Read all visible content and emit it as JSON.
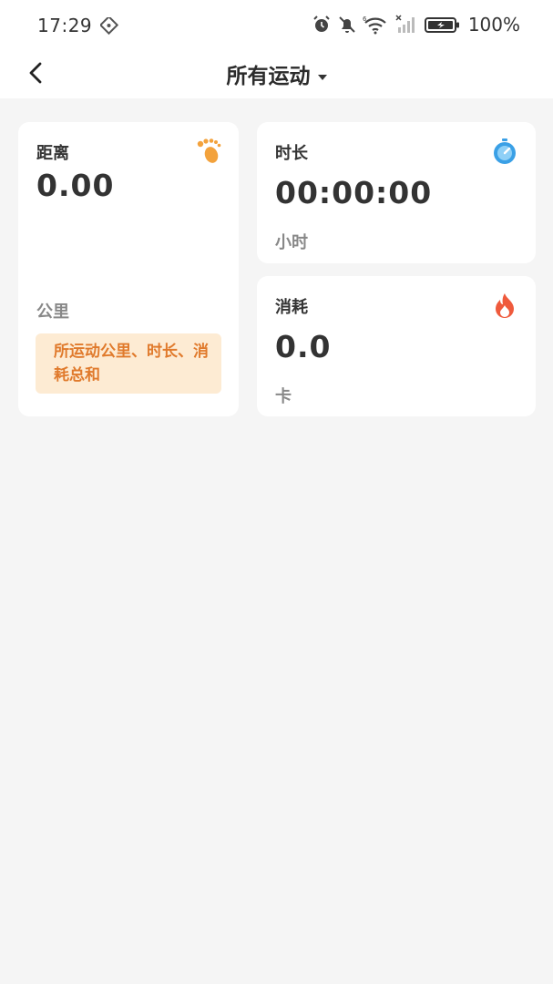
{
  "status_bar": {
    "time": "17:29",
    "battery": "100%",
    "icons": [
      "nfc-icon",
      "alarm-icon",
      "mute-icon",
      "wifi-icon",
      "signal-icon",
      "battery-icon"
    ]
  },
  "header": {
    "title": "所有运动",
    "back_icon": "back-arrow-icon",
    "dropdown_icon": "caret-down-icon"
  },
  "cards": {
    "distance": {
      "label": "距离",
      "value": "0.00",
      "unit": "公里",
      "icon": "footprint-icon",
      "note": "所运动公里、时长、消耗总和"
    },
    "duration": {
      "label": "时长",
      "value": "00:00:00",
      "unit": "小时",
      "icon": "stopwatch-icon"
    },
    "calories": {
      "label": "消耗",
      "value": "0.0",
      "unit": "卡",
      "icon": "flame-icon"
    }
  },
  "colors": {
    "background": "#f5f5f5",
    "card": "#ffffff",
    "note_bg": "#fdebd3",
    "note_text": "#e07a2c",
    "footprint": "#f3a23c",
    "stopwatch": "#3aa0e6",
    "flame": "#ef5a3c"
  }
}
